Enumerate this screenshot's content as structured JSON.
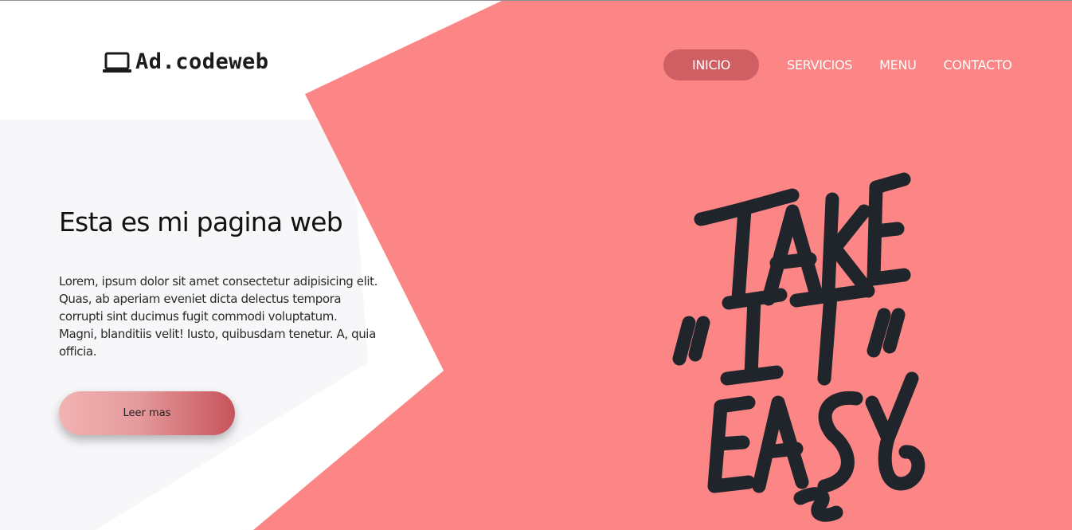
{
  "logo": {
    "icon": "laptop-icon",
    "text": "Ad.codeweb"
  },
  "nav": {
    "items": [
      {
        "label": "INICIO",
        "active": true
      },
      {
        "label": "SERVICIOS",
        "active": false
      },
      {
        "label": "MENU",
        "active": false
      },
      {
        "label": "CONTACTO",
        "active": false
      }
    ]
  },
  "hero": {
    "title": "Esta es mi pagina web",
    "text": "Lorem, ipsum dolor sit amet consectetur adipisicing elit. Quas, ab aperiam eveniet dicta delectus tempora corrupti sint ducimus fugit commodi voluptatum. Magni, blanditiis velit! Iusto, quibusdam tenetur. A, quia officia.",
    "button_label": "Leer mas"
  },
  "artwork": {
    "lines": [
      "TAKE",
      "\"IT\"",
      "EASY"
    ]
  },
  "colors": {
    "accent": "#fb8685",
    "nav_active": "#cf5f62",
    "background": "#ffffff",
    "panel": "#f8f8fa",
    "ink": "#1e2428"
  }
}
